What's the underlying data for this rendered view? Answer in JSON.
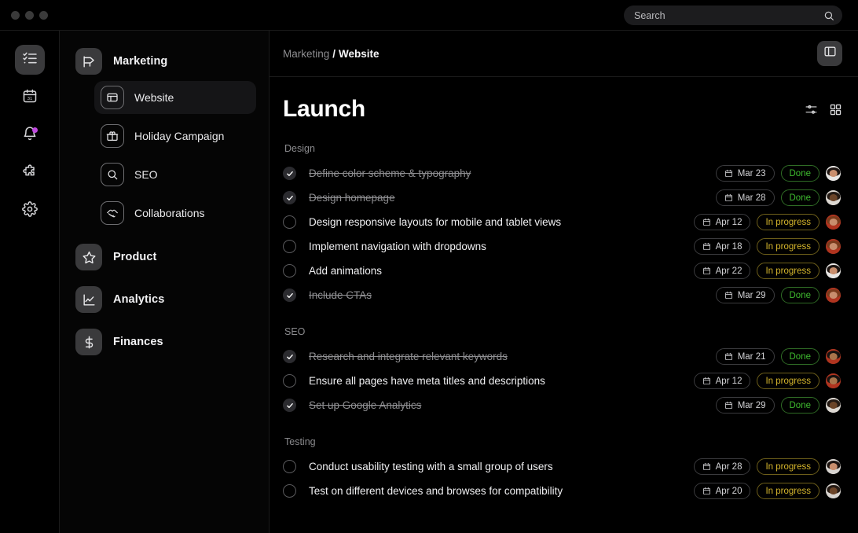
{
  "window": {
    "traffic_lights": [
      "close",
      "minimize",
      "maximize"
    ]
  },
  "search": {
    "placeholder": "Search",
    "value": "",
    "icon": "search-icon"
  },
  "rail": {
    "items": [
      {
        "icon": "checklist-icon",
        "name": "tasks",
        "active": true,
        "badge": false
      },
      {
        "icon": "calendar-icon",
        "name": "calendar",
        "active": false,
        "badge": false
      },
      {
        "icon": "bell-icon",
        "name": "notifications",
        "active": false,
        "badge": true
      },
      {
        "icon": "puzzle-icon",
        "name": "integrations",
        "active": false,
        "badge": false
      },
      {
        "icon": "gear-icon",
        "name": "settings",
        "active": false,
        "badge": false
      }
    ],
    "badge_color": "#c04ae0"
  },
  "sidebar": {
    "groups": [
      {
        "label": "Marketing",
        "icon": "megaphone-icon",
        "items": [
          {
            "label": "Website",
            "icon": "browser-window-icon",
            "active": true
          },
          {
            "label": "Holiday Campaign",
            "icon": "gift-icon",
            "active": false
          },
          {
            "label": "SEO",
            "icon": "magnifier-icon",
            "active": false
          },
          {
            "label": "Collaborations",
            "icon": "handshake-icon",
            "active": false
          }
        ]
      },
      {
        "label": "Product",
        "icon": "star-icon",
        "items": []
      },
      {
        "label": "Analytics",
        "icon": "line-chart-icon",
        "items": []
      },
      {
        "label": "Finances",
        "icon": "dollar-icon",
        "items": []
      }
    ]
  },
  "breadcrumb": {
    "parent": "Marketing",
    "separator": "/",
    "current": "Website"
  },
  "header": {
    "panel_toggle_icon": "sidebar-panel-icon"
  },
  "page": {
    "title": "Launch",
    "actions": [
      {
        "name": "filter-sliders-icon",
        "label": "Filter"
      },
      {
        "name": "grid-view-icon",
        "label": "Grid view"
      }
    ]
  },
  "colors": {
    "done": "#3fbd2f",
    "in_progress": "#d6b62c",
    "accent_purple": "#c04ae0",
    "background": "#000000",
    "surface": "#1c1c1e"
  },
  "sections": [
    {
      "title": "Design",
      "tasks": [
        {
          "name": "Define color scheme & typography",
          "done": true,
          "date": "Mar 23",
          "status": "Done",
          "avatar": {
            "skin": "#c98e6d",
            "hair": "#1c1411",
            "body": "#e8e6e4"
          }
        },
        {
          "name": "Design homepage",
          "done": true,
          "date": "Mar 28",
          "status": "Done",
          "avatar": {
            "skin": "#6b4428",
            "hair": "#241a14",
            "body": "#ddd8d2"
          }
        },
        {
          "name": "Design responsive layouts for mobile and tablet views",
          "done": false,
          "date": "Apr 12",
          "status": "In progress",
          "avatar": {
            "skin": "#c98e6d",
            "hair": "#7a3b1c",
            "body": "#b0341f"
          }
        },
        {
          "name": "Implement navigation with dropdowns",
          "done": false,
          "date": "Apr 18",
          "status": "In progress",
          "avatar": {
            "skin": "#c98e6d",
            "hair": "#7a3b1c",
            "body": "#b0341f"
          }
        },
        {
          "name": "Add animations",
          "done": false,
          "date": "Apr 22",
          "status": "In progress",
          "avatar": {
            "skin": "#c98e6d",
            "hair": "#1c1411",
            "body": "#e8e6e4"
          }
        },
        {
          "name": "Include CTAs",
          "done": true,
          "date": "Mar 29",
          "status": "Done",
          "avatar": {
            "skin": "#c98e6d",
            "hair": "#7a3b1c",
            "body": "#b0341f"
          }
        }
      ]
    },
    {
      "title": "SEO",
      "tasks": [
        {
          "name": "Research and integrate relevant keywords",
          "done": true,
          "date": "Mar 21",
          "status": "Done",
          "avatar": {
            "skin": "#a9744b",
            "hair": "#171210",
            "body": "#b0341f"
          }
        },
        {
          "name": "Ensure all pages have meta titles and descriptions",
          "done": false,
          "date": "Apr 12",
          "status": "In progress",
          "avatar": {
            "skin": "#a9744b",
            "hair": "#171210",
            "body": "#b0341f"
          }
        },
        {
          "name": "Set up Google Analytics",
          "done": true,
          "date": "Mar 29",
          "status": "Done",
          "avatar": {
            "skin": "#6b4428",
            "hair": "#241a14",
            "body": "#ddd8d2"
          }
        }
      ]
    },
    {
      "title": "Testing",
      "tasks": [
        {
          "name": "Conduct usability testing with a small group of users",
          "done": false,
          "date": "Apr 28",
          "status": "In progress",
          "avatar": {
            "skin": "#c98e6d",
            "hair": "#1c1411",
            "body": "#d8d4d0"
          }
        },
        {
          "name": "Test on different devices and browses for compatibility",
          "done": false,
          "date": "Apr 20",
          "status": "In progress",
          "avatar": {
            "skin": "#6b4428",
            "hair": "#241a14",
            "body": "#d8d4d0"
          }
        }
      ]
    }
  ]
}
